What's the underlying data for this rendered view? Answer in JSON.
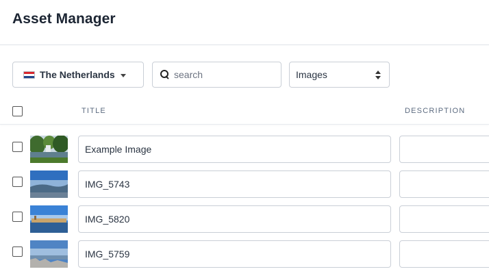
{
  "app": {
    "title": "Asset Manager"
  },
  "toolbar": {
    "locale_label": "The Netherlands",
    "search_placeholder": "search",
    "search_value": "",
    "type_selected": "Images"
  },
  "table": {
    "columns": [
      "TITLE",
      "DESCRIPTION"
    ],
    "rows": [
      {
        "title": "Example Image",
        "description": ""
      },
      {
        "title": "IMG_5743",
        "description": ""
      },
      {
        "title": "IMG_5820",
        "description": ""
      },
      {
        "title": "IMG_5759",
        "description": ""
      }
    ]
  },
  "icons": {
    "flag": "netherlands-flag-icon",
    "locale_caret": "caret-down-icon",
    "search": "search-icon",
    "select": "updown-chevron-icon"
  },
  "colors": {
    "text_primary": "#1c2533",
    "header_muted": "#5c6b80",
    "border": "#c9ced6",
    "flag_red": "#d8272e",
    "flag_blue": "#21468b"
  }
}
